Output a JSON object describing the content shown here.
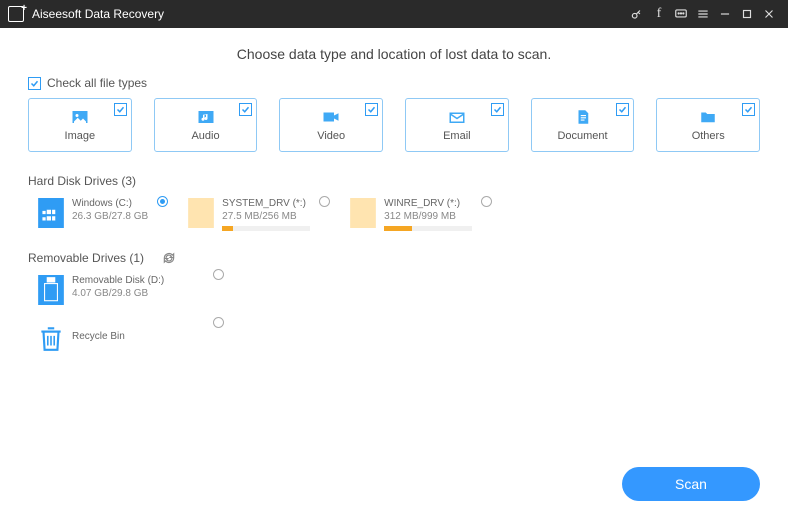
{
  "app": {
    "title": "Aiseesoft Data Recovery"
  },
  "heading": "Choose data type and location of lost data to scan.",
  "check_all_label": "Check all file types",
  "types": [
    {
      "label": "Image"
    },
    {
      "label": "Audio"
    },
    {
      "label": "Video"
    },
    {
      "label": "Email"
    },
    {
      "label": "Document"
    },
    {
      "label": "Others"
    }
  ],
  "hdd": {
    "title": "Hard Disk Drives (3)",
    "items": [
      {
        "name": "Windows (C:)",
        "size": "26.3 GB/27.8 GB",
        "fill_pct": 95,
        "color": "#2f9cf4",
        "icon": "win"
      },
      {
        "name": "SYSTEM_DRV (*:)",
        "size": "27.5 MB/256 MB",
        "fill_pct": 12,
        "color": "#f5a623",
        "icon": "vol"
      },
      {
        "name": "WINRE_DRV (*:)",
        "size": "312 MB/999 MB",
        "fill_pct": 32,
        "color": "#f5a623",
        "icon": "vol"
      }
    ]
  },
  "removable": {
    "title": "Removable Drives (1)",
    "item": {
      "name": "Removable Disk (D:)",
      "size": "4.07 GB/29.8 GB"
    }
  },
  "recycle": {
    "label": "Recycle Bin"
  },
  "scan_label": "Scan"
}
